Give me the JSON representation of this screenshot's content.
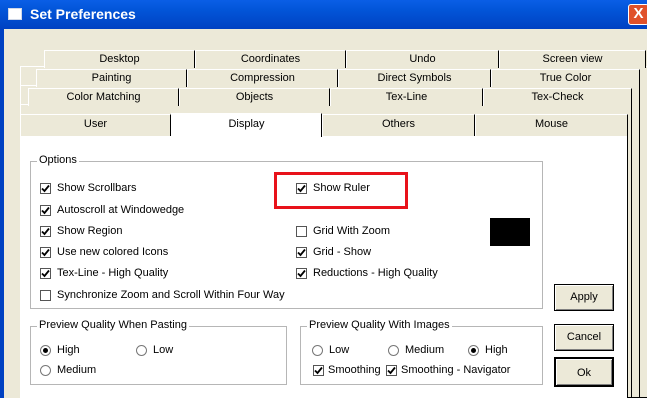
{
  "window": {
    "title": "Set Preferences",
    "close_label": "X"
  },
  "tabs": {
    "row1": [
      "Desktop",
      "Coordinates",
      "Undo",
      "Screen view"
    ],
    "row2": [
      "Painting",
      "Compression",
      "Direct Symbols",
      "True Color"
    ],
    "row3": [
      "Color Matching",
      "Objects",
      "Tex-Line",
      "Tex-Check"
    ],
    "row4": [
      "User",
      "Display",
      "Others",
      "Mouse"
    ],
    "active": "Display"
  },
  "options": {
    "title": "Options",
    "show_scrollbars": "Show Scrollbars",
    "autoscroll": "Autoscroll at Windowedge",
    "show_region": "Show Region",
    "colored_icons": "Use new colored Icons",
    "texline_hq": "Tex-Line - High Quality",
    "sync_zoom": "Synchronize Zoom and Scroll Within Four Way",
    "show_ruler": "Show Ruler",
    "grid_with_zoom": "Grid With Zoom",
    "grid_show": "Grid - Show",
    "reductions_hq": "Reductions - High Quality"
  },
  "checked": {
    "show_scrollbars": true,
    "autoscroll": true,
    "show_region": true,
    "colored_icons": true,
    "texline_hq": true,
    "sync_zoom": false,
    "show_ruler": true,
    "grid_with_zoom": false,
    "grid_show": true,
    "reductions_hq": true,
    "smoothing": true,
    "smoothing_navigator": true
  },
  "preview_pasting": {
    "title": "Preview Quality When Pasting",
    "high": "High",
    "low": "Low",
    "medium": "Medium",
    "selected": "High"
  },
  "preview_images": {
    "title": "Preview Quality With Images",
    "low": "Low",
    "medium": "Medium",
    "high": "High",
    "selected": "High",
    "smoothing": "Smoothing",
    "smoothing_navigator": "Smoothing - Navigator"
  },
  "buttons": {
    "apply": "Apply",
    "cancel": "Cancel",
    "ok": "Ok"
  },
  "colors": {
    "highlight": "#e8121a",
    "swatch": "#000000",
    "titlebar": "#0255d8",
    "close": "#e0512a"
  }
}
